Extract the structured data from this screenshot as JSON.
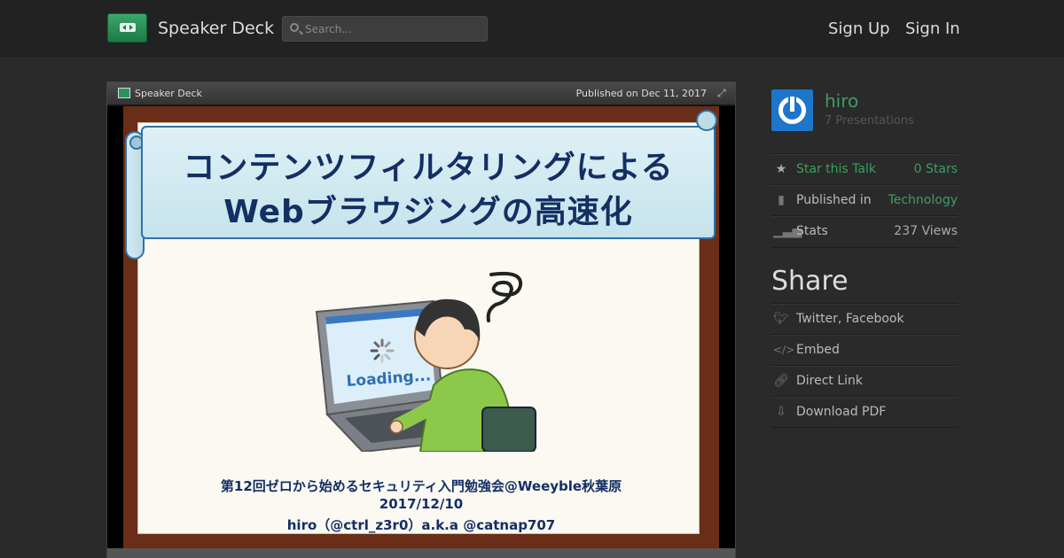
{
  "header": {
    "brand": "Speaker Deck",
    "search_placeholder": "Search...",
    "sign_up": "Sign Up",
    "sign_in": "Sign In"
  },
  "player": {
    "brand": "Speaker Deck",
    "published": "Published on Dec 11, 2017",
    "slide": {
      "title_line1": "コンテンツフィルタリングによる",
      "title_line2": "Webブラウジングの高速化",
      "illustration_text": "Loading...",
      "event": "第12回ゼロから始めるセキュリティ入門勉強会@Weeyble秋葉原",
      "date": "2017/12/10",
      "author": "hiro（@ctrl_z3r0）a.k.a @catnap707"
    }
  },
  "sidebar": {
    "author_name": "hiro",
    "author_presentations": "7 Presentations",
    "rows": [
      {
        "label": "Star this Talk",
        "value": "0 Stars",
        "icon": "star-icon"
      },
      {
        "label": "Published in",
        "value": "Technology",
        "icon": "bookmark-icon"
      },
      {
        "label": "Stats",
        "value": "237 Views",
        "icon": "bar-chart-icon"
      }
    ],
    "share_title": "Share",
    "share_items": [
      {
        "label": "Twitter, Facebook",
        "icon": "bird-icon"
      },
      {
        "label": "Embed",
        "icon": "code-icon"
      },
      {
        "label": "Direct Link",
        "icon": "link-icon"
      },
      {
        "label": "Download PDF",
        "icon": "download-icon"
      }
    ]
  },
  "colors": {
    "accent_green": "#3a9f63",
    "avatar_blue": "#1d76c9",
    "slide_title": "#132f63"
  }
}
